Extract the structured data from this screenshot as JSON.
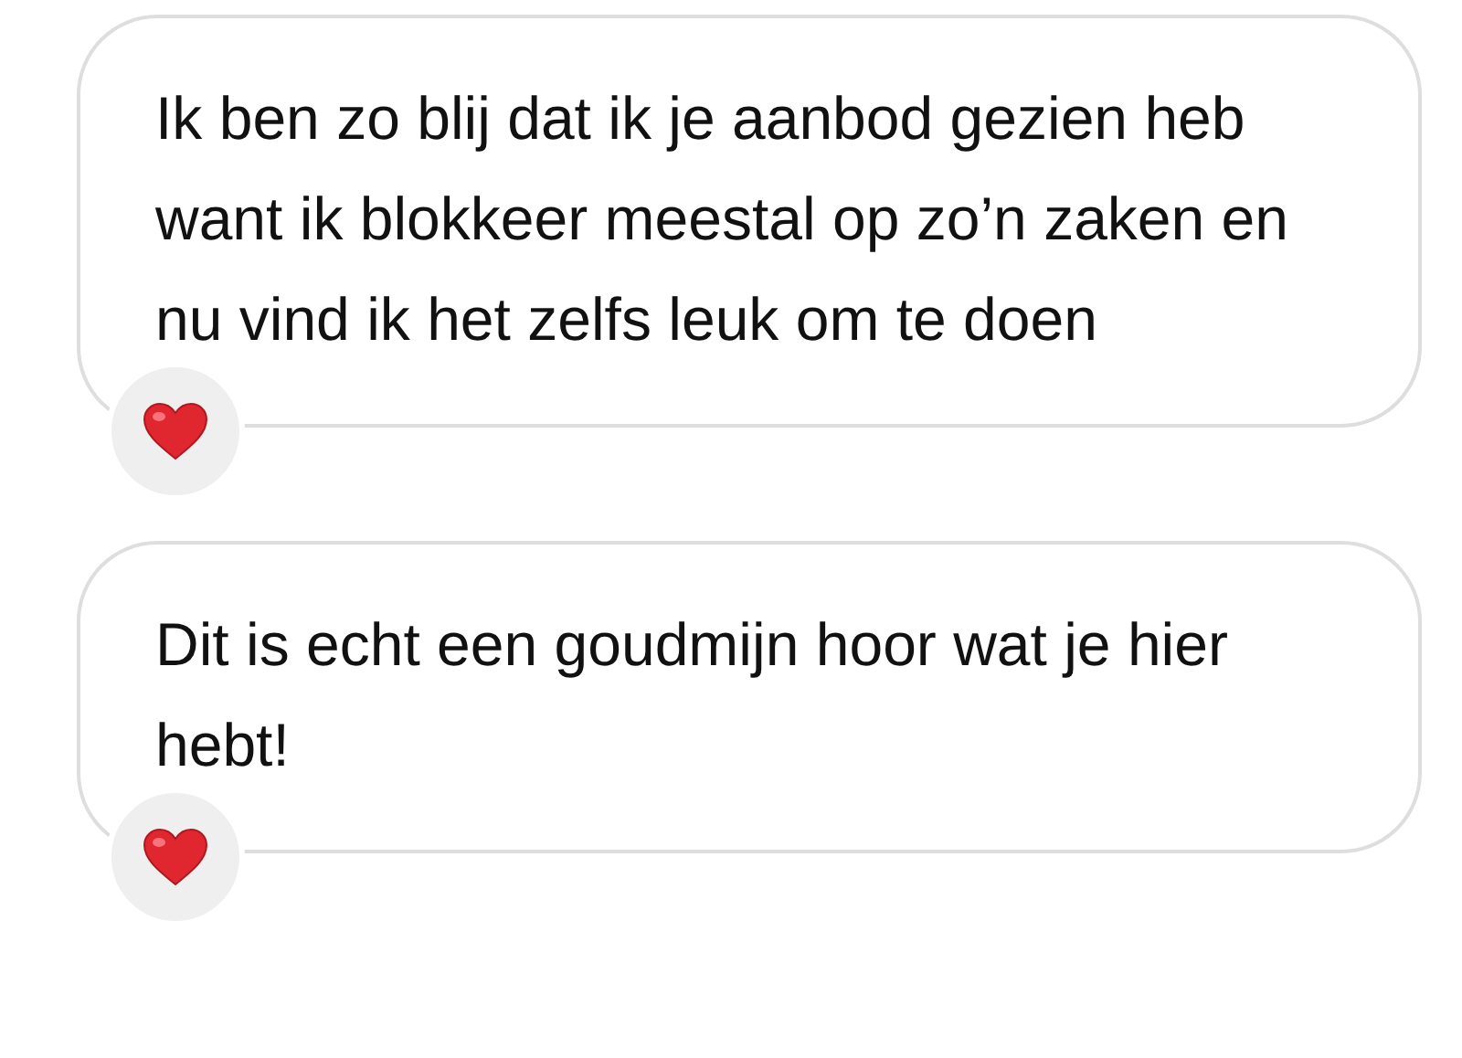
{
  "messages": [
    {
      "text": "Ik ben zo blij dat ik je aanbod gezien heb want ik blokkeer meestal op zo’n zaken en nu vind ik het zelfs leuk om te doen",
      "reaction": {
        "kind": "heart"
      }
    },
    {
      "text": "Dit is echt een goudmijn hoor wat je hier hebt!",
      "reaction": {
        "kind": "heart"
      }
    }
  ]
}
